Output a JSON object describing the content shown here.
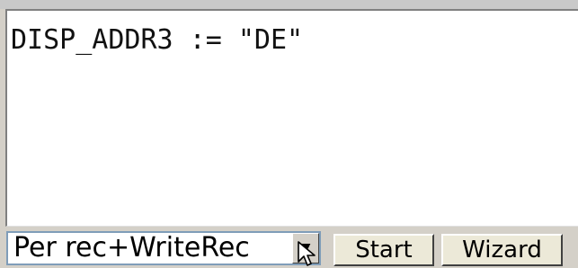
{
  "editor": {
    "code": "DISP_ADDR3 := \"DE\""
  },
  "controls": {
    "mode_select_value": "Per rec+WriteRec",
    "dropdown_arrow_glyph": "▼",
    "start_label": "Start",
    "wizard_label": "Wizard"
  },
  "colors": {
    "background": "#d4d0c8",
    "editor_background": "#ffffff",
    "select_border": "#7f9db9"
  },
  "icons": {
    "cursor": "mouse-pointer-icon",
    "dropdown": "chevron-down-icon"
  }
}
